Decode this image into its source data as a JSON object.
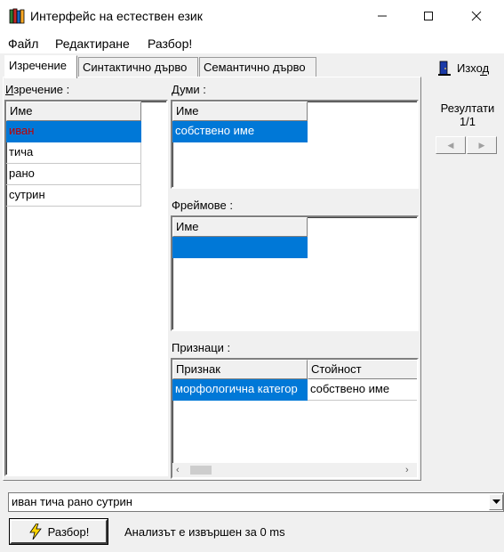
{
  "window": {
    "title": "Интерфейс на естествен език",
    "icon": "books-icon"
  },
  "menu": {
    "items": [
      "Файл",
      "Редактиране",
      "Разбор!"
    ]
  },
  "tabs": [
    {
      "label": "Изречение",
      "active": true
    },
    {
      "label": "Синтактично дърво",
      "active": false
    },
    {
      "label": "Семантично дърво",
      "active": false
    }
  ],
  "sentence_panel": {
    "label": "Изречение :",
    "column": "Име",
    "words": [
      "иван",
      "тича",
      "рано",
      "сутрин"
    ],
    "selected_index": 0,
    "selected_color": "#c00000"
  },
  "words_panel": {
    "label": "Думи :",
    "column": "Име",
    "rows": [
      "собствено име"
    ]
  },
  "frames_panel": {
    "label": "Фреймове :",
    "column": "Име",
    "rows": [
      ""
    ]
  },
  "features_panel": {
    "label": "Признаци :",
    "columns": [
      "Признак",
      "Стойност"
    ],
    "rows": [
      [
        "морфологична категор",
        "собствено име"
      ]
    ]
  },
  "exit": {
    "label": "Изход",
    "icon": "door-exit-icon"
  },
  "results": {
    "label": "Резултати",
    "count": "1/1"
  },
  "input": {
    "value": "иван тича рано сутрин"
  },
  "parse_button": {
    "label": "Разбор!",
    "icon": "lightning-icon"
  },
  "status": "Анализът е извършен за 0 ms",
  "colors": {
    "selection": "#0078d7",
    "window_bg": "#f0f0f0"
  }
}
